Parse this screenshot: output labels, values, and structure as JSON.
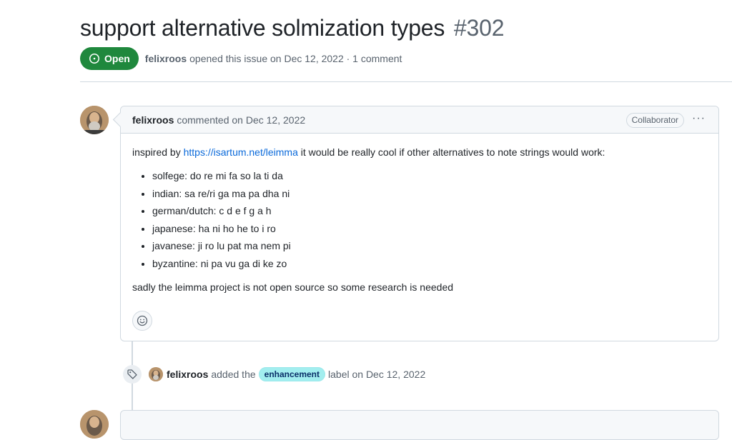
{
  "issue": {
    "title": "support alternative solmization types",
    "number": "#302",
    "state": "Open",
    "author": "felixroos",
    "opened_text": "opened this issue on Dec 12, 2022 · 1 comment"
  },
  "comment": {
    "author": "felixroos",
    "meta": "commented on Dec 12, 2022",
    "role_badge": "Collaborator",
    "more_actions": "···",
    "intro_before": "inspired by ",
    "intro_link": "https://isartum.net/leimma",
    "intro_after": " it would be really cool if other alternatives to note strings would work:",
    "items": [
      "solfege: do re mi fa so la ti da",
      "indian: sa re/ri ga ma pa dha ni",
      "german/dutch: c d e f g a h",
      "japanese: ha ni ho he to i ro",
      "javanese: ji ro lu pat ma nem pi",
      "byzantine: ni pa vu ga di ke zo"
    ],
    "closing": "sadly the leimma project is not open source so some research is needed"
  },
  "event": {
    "author": "felixroos",
    "before": "added the",
    "label": "enhancement",
    "after": "label on Dec 12, 2022"
  },
  "colors": {
    "open_green": "#1f883d",
    "link_blue": "#0969da",
    "label_bg": "#a2eeef"
  },
  "icons": [
    "issue-opened-icon",
    "smiley-icon",
    "tag-icon",
    "kebab-icon"
  ]
}
